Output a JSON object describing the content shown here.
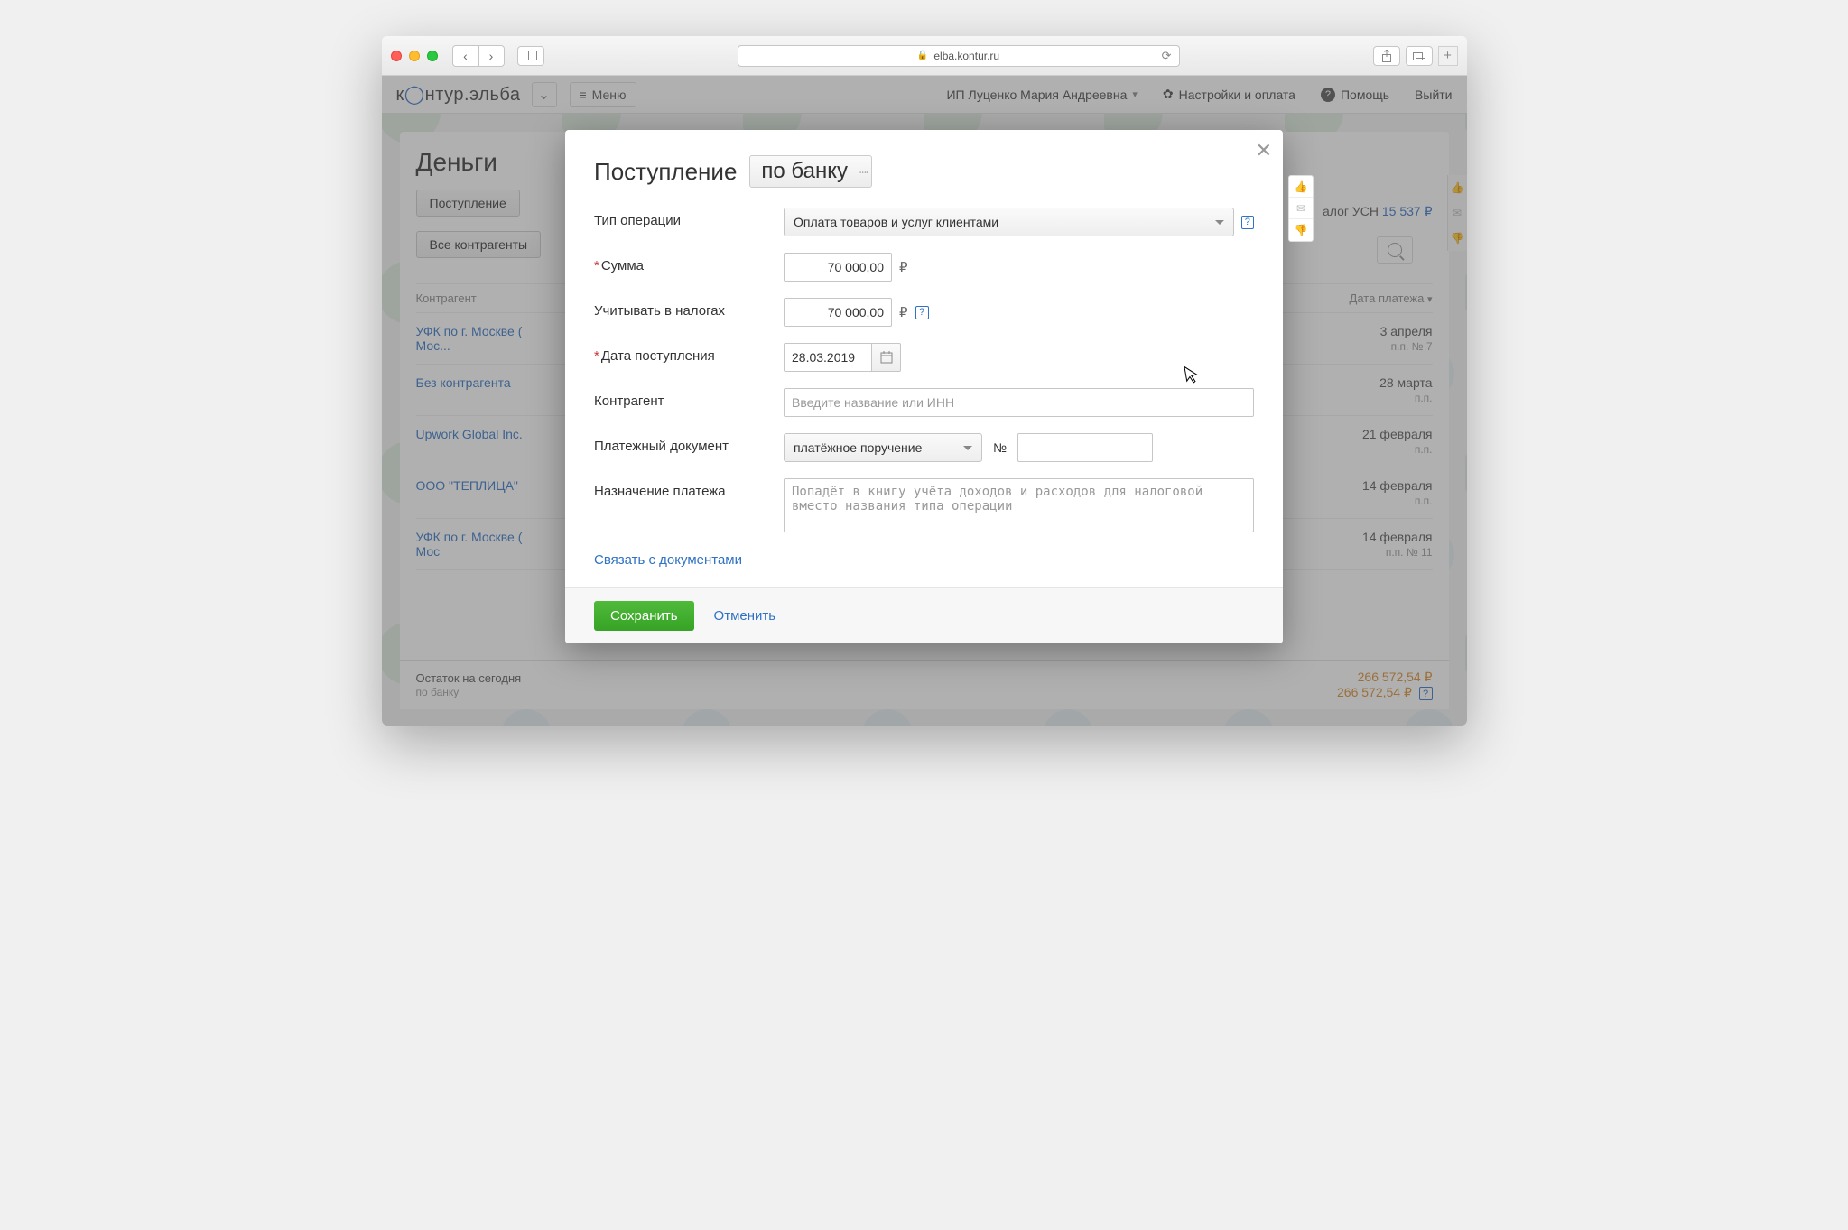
{
  "browser": {
    "url": "elba.kontur.ru"
  },
  "app_header": {
    "logo_prefix": "к",
    "logo_o": "○",
    "logo_rest": "нтур.эльба",
    "menu_label": "Меню",
    "user": "ИП Луценко Мария Андреевна",
    "settings": "Настройки и оплата",
    "help": "Помощь",
    "logout": "Выйти"
  },
  "bg": {
    "title": "Деньги",
    "btn_income": "Поступление",
    "btn_all_counterparties": "Все контрагенты",
    "col_counterparty": "Контрагент",
    "col_date": "Дата платежа",
    "tax_label": "алог УСН",
    "tax_amount": "15 537 ₽",
    "rows": [
      {
        "name": "УФК по г. Москве (\nМос...",
        "date": "3 апреля",
        "sub": "п.п. № 7"
      },
      {
        "name": "Без контрагента",
        "date": "28 марта",
        "sub": "п.п."
      },
      {
        "name": "Upwork Global Inc.",
        "date": "21 февраля",
        "sub": "п.п."
      },
      {
        "name": "ООО \"ТЕПЛИЦА\"",
        "date": "14 февраля",
        "sub": "п.п."
      },
      {
        "name": "УФК по г. Москве (\nМос",
        "date": "14 февраля",
        "sub": "п.п. № 11"
      }
    ],
    "balance_label": "Остаток на сегодня",
    "balance_sub": "по банку",
    "balance_val1": "266 572,54 ₽",
    "balance_val2": "266 572,54 ₽"
  },
  "modal": {
    "title": "Поступление",
    "dropdown_value": "по банку",
    "op_type_label": "Тип операции",
    "op_type_value": "Оплата товаров и услуг клиентами",
    "amount_label": "Сумма",
    "amount_value": "70 000,00",
    "tax_amount_label": "Учитывать в налогах",
    "tax_amount_value": "70 000,00",
    "date_label": "Дата поступления",
    "date_value": "28.03.2019",
    "counterparty_label": "Контрагент",
    "counterparty_placeholder": "Введите название или ИНН",
    "payment_doc_label": "Платежный документ",
    "payment_doc_value": "платёжное поручение",
    "payment_num_label": "№",
    "purpose_label": "Назначение платежа",
    "purpose_placeholder": "Попадёт в книгу учёта доходов и расходов для налоговой вместо названия типа операции",
    "link_docs": "Связать с документами",
    "save": "Сохранить",
    "cancel": "Отменить",
    "ruble": "₽",
    "help": "?"
  }
}
